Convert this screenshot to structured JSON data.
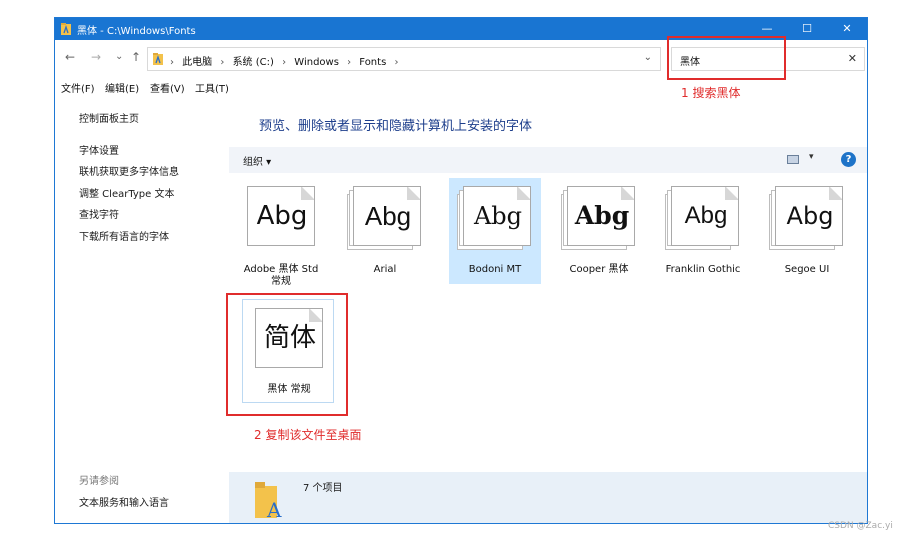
{
  "window": {
    "title": "黑体 - C:\\Windows\\Fonts",
    "minimize_glyph": "—",
    "maximize_glyph": "☐",
    "close_glyph": "✕"
  },
  "nav": {
    "back_glyph": "←",
    "forward_glyph": "→",
    "recent_glyph": "⌄",
    "up_glyph": "↑",
    "refresh_glyph": "↻",
    "dropdown_glyph": "⌄"
  },
  "address": {
    "crumbs": [
      "此电脑",
      "系统 (C:)",
      "Windows",
      "Fonts"
    ],
    "separator": "›"
  },
  "search": {
    "value": "黑体",
    "clear_glyph": "✕"
  },
  "menu": [
    "文件(F)",
    "编辑(E)",
    "查看(V)",
    "工具(T)"
  ],
  "sidebar": {
    "home": "控制面板主页",
    "links": [
      "字体设置",
      "联机获取更多字体信息",
      "调整 ClearType 文本",
      "查找字符",
      "下载所有语言的字体"
    ],
    "see_also": "另请参阅",
    "see_also_links": [
      "文本服务和输入语言"
    ]
  },
  "main": {
    "heading": "预览、删除或者显示和隐藏计算机上安装的字体",
    "organize": "组织 ▾",
    "view_dd": "▾",
    "help": "?"
  },
  "fonts": [
    {
      "sample": "Abg",
      "name": "Adobe 黑体 Std",
      "name2": "常规"
    },
    {
      "sample": "Abg",
      "name": "Arial",
      "name2": ""
    },
    {
      "sample": "Abg",
      "name": "Bodoni MT",
      "name2": ""
    },
    {
      "sample": "Abg",
      "name": "Cooper 黑体",
      "name2": ""
    },
    {
      "sample": "Abg",
      "name": "Franklin Gothic",
      "name2": ""
    },
    {
      "sample": "Abg",
      "name": "Segoe UI",
      "name2": ""
    },
    {
      "sample": "简体",
      "name": "黑体 常规",
      "name2": ""
    }
  ],
  "status": {
    "count": "7 个项目",
    "icon_letter": "A"
  },
  "annotations": {
    "step1": "1 搜索黑体",
    "step2": "2 复制该文件至桌面",
    "color": "#e02c2c"
  },
  "watermark": "CSDN @Zac.yi",
  "colors": {
    "titlebar": "#1975d2",
    "heading": "#1e3f8c",
    "selected": "#cce8ff"
  }
}
